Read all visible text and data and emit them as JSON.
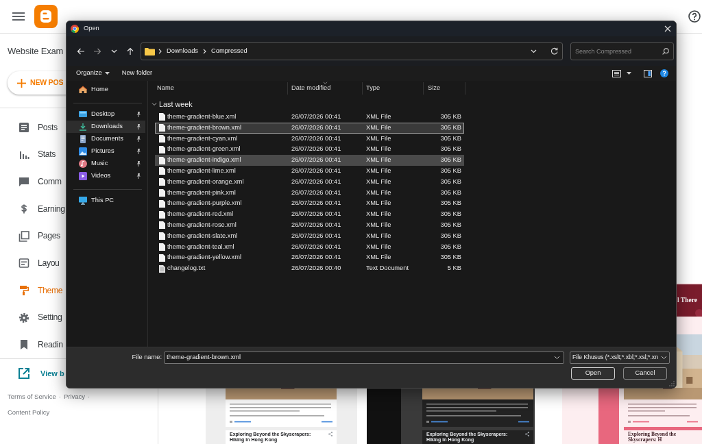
{
  "blogger": {
    "blog_title": "Website Exam",
    "new_post_button": "NEW POS",
    "sidebar": {
      "items": [
        {
          "label": "Posts",
          "selected": false
        },
        {
          "label": "Stats",
          "selected": false
        },
        {
          "label": "Comm",
          "selected": false
        },
        {
          "label": "Earning",
          "selected": false
        },
        {
          "label": "Pages",
          "selected": false
        },
        {
          "label": "Layou",
          "selected": false
        },
        {
          "label": "Theme",
          "selected": true
        },
        {
          "label": "Setting",
          "selected": false
        },
        {
          "label": "Readin",
          "selected": false
        }
      ]
    },
    "view_blog": "View b",
    "footer_links": [
      {
        "label": "Terms of Service",
        "separator": "·"
      },
      {
        "label": "Privacy",
        "separator": "·"
      },
      {
        "label": "Content Policy"
      }
    ]
  },
  "theme_previews": [
    {
      "kind": "light",
      "heading": "Exploring Beyond the Skyscrapers: Hiking in Hong Kong"
    },
    {
      "kind": "dark",
      "heading": "Exploring Beyond the Skyscrapers: Hiking in Hong Kong"
    },
    {
      "kind": "rose",
      "banner_title": "l There",
      "heading": "Exploring Beyond the Skyscrapers: H"
    }
  ],
  "dialog": {
    "title": "Open",
    "address_bar": {
      "breadcrumb": [
        "Downloads",
        "Compressed"
      ]
    },
    "search": {
      "placeholder": "Search Compressed"
    },
    "toolbar": [
      {
        "label": "Organize",
        "dropdown": true
      },
      {
        "label": "New folder",
        "dropdown": false
      }
    ],
    "nav_pane": {
      "groups": [
        {
          "items": [
            {
              "label": "Home",
              "pinned": false,
              "selected": false
            }
          ]
        },
        {
          "items": [
            {
              "label": "Desktop",
              "pinned": true,
              "selected": false
            },
            {
              "label": "Downloads",
              "pinned": true,
              "selected": true
            },
            {
              "label": "Documents",
              "pinned": true,
              "selected": false
            },
            {
              "label": "Pictures",
              "pinned": true,
              "selected": false
            },
            {
              "label": "Music",
              "pinned": true,
              "selected": false
            },
            {
              "label": "Videos",
              "pinned": true,
              "selected": false
            }
          ]
        },
        {
          "items": [
            {
              "label": "This PC",
              "pinned": false,
              "selected": false
            }
          ]
        }
      ]
    },
    "file_list": {
      "columns": [
        {
          "label": "Name",
          "sorted": false
        },
        {
          "label": "Date modified",
          "sorted": true
        },
        {
          "label": "Type",
          "sorted": false
        },
        {
          "label": "Size",
          "sorted": false
        }
      ],
      "group": {
        "label": "Last week",
        "expanded": true
      },
      "files": [
        {
          "name": "theme-gradient-blue.xml",
          "date": "26/07/2026 00:41",
          "type": "XML File",
          "size": "305 KB",
          "kind": "xml",
          "selected": false,
          "hovered": false
        },
        {
          "name": "theme-gradient-brown.xml",
          "date": "26/07/2026 00:41",
          "type": "XML File",
          "size": "305 KB",
          "kind": "xml",
          "selected": true,
          "hovered": false
        },
        {
          "name": "theme-gradient-cyan.xml",
          "date": "26/07/2026 00:41",
          "type": "XML File",
          "size": "305 KB",
          "kind": "xml",
          "selected": false,
          "hovered": false
        },
        {
          "name": "theme-gradient-green.xml",
          "date": "26/07/2026 00:41",
          "type": "XML File",
          "size": "305 KB",
          "kind": "xml",
          "selected": false,
          "hovered": false
        },
        {
          "name": "theme-gradient-indigo.xml",
          "date": "26/07/2026 00:41",
          "type": "XML File",
          "size": "305 KB",
          "kind": "xml",
          "selected": false,
          "hovered": true
        },
        {
          "name": "theme-gradient-lime.xml",
          "date": "26/07/2026 00:41",
          "type": "XML File",
          "size": "305 KB",
          "kind": "xml",
          "selected": false,
          "hovered": false
        },
        {
          "name": "theme-gradient-orange.xml",
          "date": "26/07/2026 00:41",
          "type": "XML File",
          "size": "305 KB",
          "kind": "xml",
          "selected": false,
          "hovered": false
        },
        {
          "name": "theme-gradient-pink.xml",
          "date": "26/07/2026 00:41",
          "type": "XML File",
          "size": "305 KB",
          "kind": "xml",
          "selected": false,
          "hovered": false
        },
        {
          "name": "theme-gradient-purple.xml",
          "date": "26/07/2026 00:41",
          "type": "XML File",
          "size": "305 KB",
          "kind": "xml",
          "selected": false,
          "hovered": false
        },
        {
          "name": "theme-gradient-red.xml",
          "date": "26/07/2026 00:41",
          "type": "XML File",
          "size": "305 KB",
          "kind": "xml",
          "selected": false,
          "hovered": false
        },
        {
          "name": "theme-gradient-rose.xml",
          "date": "26/07/2026 00:41",
          "type": "XML File",
          "size": "305 KB",
          "kind": "xml",
          "selected": false,
          "hovered": false
        },
        {
          "name": "theme-gradient-slate.xml",
          "date": "26/07/2026 00:41",
          "type": "XML File",
          "size": "305 KB",
          "kind": "xml",
          "selected": false,
          "hovered": false
        },
        {
          "name": "theme-gradient-teal.xml",
          "date": "26/07/2026 00:41",
          "type": "XML File",
          "size": "305 KB",
          "kind": "xml",
          "selected": false,
          "hovered": false
        },
        {
          "name": "theme-gradient-yellow.xml",
          "date": "26/07/2026 00:41",
          "type": "XML File",
          "size": "305 KB",
          "kind": "xml",
          "selected": false,
          "hovered": false
        },
        {
          "name": "changelog.txt",
          "date": "26/07/2026 00:40",
          "type": "Text Document",
          "size": "5 KB",
          "kind": "text",
          "selected": false,
          "hovered": false
        }
      ]
    },
    "file_name_label": "File name:",
    "file_name": "theme-gradient-brown.xml",
    "file_type": "File Khusus (*.xslt;*.xbl;*.xsl;*.xn",
    "buttons": [
      {
        "label": "Open",
        "default": true
      },
      {
        "label": "Cancel",
        "default": false
      }
    ]
  }
}
